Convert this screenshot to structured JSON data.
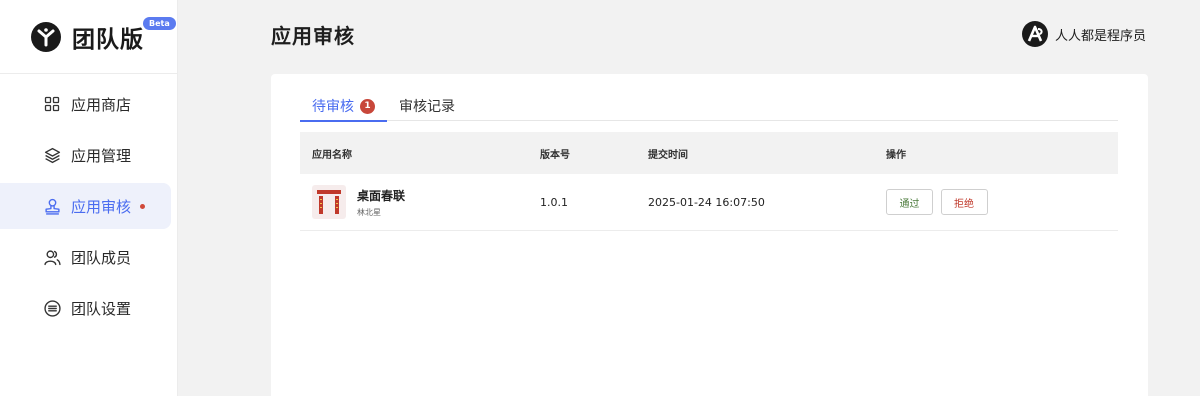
{
  "brand": {
    "title": "团队版",
    "badge": "Beta"
  },
  "sidebar": {
    "items": [
      {
        "label": "应用商店",
        "icon": "grid-icon",
        "active": false
      },
      {
        "label": "应用管理",
        "icon": "layers-icon",
        "active": false
      },
      {
        "label": "应用审核",
        "icon": "stamp-icon",
        "active": true
      },
      {
        "label": "团队成员",
        "icon": "users-icon",
        "active": false
      },
      {
        "label": "团队设置",
        "icon": "menu-circle-icon",
        "active": false
      }
    ]
  },
  "header": {
    "title": "应用审核",
    "brand_text": "人人都是程序员"
  },
  "tabs": [
    {
      "label": "待审核",
      "count": "1",
      "active": true
    },
    {
      "label": "审核记录",
      "active": false
    }
  ],
  "table": {
    "columns": [
      "应用名称",
      "版本号",
      "提交时间",
      "操作"
    ],
    "rows": [
      {
        "name": "桌面春联",
        "author": "林北星",
        "version": "1.0.1",
        "submitted": "2025-01-24 16:07:50",
        "approve": "通过",
        "reject": "拒绝"
      }
    ]
  },
  "colors": {
    "accent": "#4a6cf0",
    "badge": "#c8473a",
    "reject": "#c0392b",
    "approve": "#4a7a3a"
  }
}
